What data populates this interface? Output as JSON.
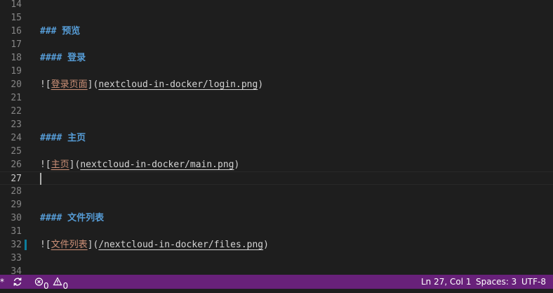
{
  "editor": {
    "lines": [
      {
        "num": "14",
        "parts": []
      },
      {
        "num": "15",
        "parts": []
      },
      {
        "num": "16",
        "parts": [
          {
            "t": "### 预览",
            "c": "heading"
          }
        ]
      },
      {
        "num": "17",
        "parts": []
      },
      {
        "num": "18",
        "parts": [
          {
            "t": "#### 登录",
            "c": "heading"
          }
        ]
      },
      {
        "num": "19",
        "parts": []
      },
      {
        "num": "20",
        "parts": [
          {
            "t": "![",
            "c": "plain"
          },
          {
            "t": "登录页面",
            "c": "alt"
          },
          {
            "t": "](",
            "c": "plain"
          },
          {
            "t": "nextcloud-in-docker/login.png",
            "c": "url"
          },
          {
            "t": ")",
            "c": "plain"
          }
        ]
      },
      {
        "num": "21",
        "parts": []
      },
      {
        "num": "22",
        "parts": []
      },
      {
        "num": "23",
        "parts": []
      },
      {
        "num": "24",
        "parts": [
          {
            "t": "#### 主页",
            "c": "heading"
          }
        ]
      },
      {
        "num": "25",
        "parts": []
      },
      {
        "num": "26",
        "parts": [
          {
            "t": "![",
            "c": "plain"
          },
          {
            "t": "主页",
            "c": "alt"
          },
          {
            "t": "](",
            "c": "plain"
          },
          {
            "t": "nextcloud-in-docker/main.png",
            "c": "url"
          },
          {
            "t": ")",
            "c": "plain"
          }
        ]
      },
      {
        "num": "27",
        "parts": [],
        "current": true
      },
      {
        "num": "28",
        "parts": []
      },
      {
        "num": "29",
        "parts": []
      },
      {
        "num": "30",
        "parts": [
          {
            "t": "#### 文件列表",
            "c": "heading"
          }
        ]
      },
      {
        "num": "31",
        "parts": []
      },
      {
        "num": "32",
        "parts": [
          {
            "t": "![",
            "c": "plain"
          },
          {
            "t": "文件列表",
            "c": "alt"
          },
          {
            "t": "](",
            "c": "plain"
          },
          {
            "t": "/nextcloud-in-docker/files.png",
            "c": "url"
          },
          {
            "t": ")",
            "c": "plain"
          }
        ],
        "modified": true
      },
      {
        "num": "33",
        "parts": []
      },
      {
        "num": "34",
        "parts": []
      }
    ]
  },
  "statusbar": {
    "branch_glyph": "*",
    "sync_icon": "sync-icon",
    "errors_count": "0",
    "warnings_count": "0",
    "cursor_position": "Ln 27, Col 1",
    "indentation": "Spaces: 3",
    "encoding": "UTF-8",
    "background_color": "#68217a"
  },
  "colors": {
    "editor_background": "#1e1e1e",
    "heading": "#569cd6",
    "link_text": "#ce9178",
    "plain_text": "#d4d4d4",
    "line_number": "#858585",
    "modified_gutter": "#0c7d9d"
  }
}
